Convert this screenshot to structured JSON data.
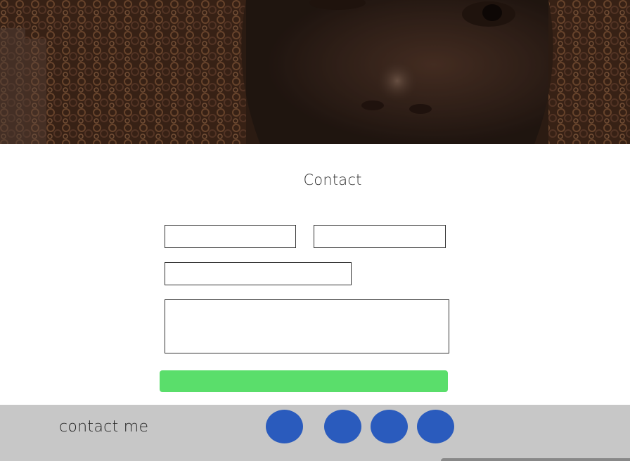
{
  "contact_section": {
    "title": "Contact",
    "form": {
      "first_name_value": "",
      "last_name_value": "",
      "email_value": "",
      "message_value": "",
      "submit_label": ""
    }
  },
  "footer": {
    "label": "contact me",
    "social_icons": [
      "social-icon",
      "social-icon",
      "social-icon",
      "social-icon"
    ]
  },
  "colors": {
    "submit": "#5ade6b",
    "social": "#2a5bbd",
    "footer_bg": "#c7c7c7"
  }
}
